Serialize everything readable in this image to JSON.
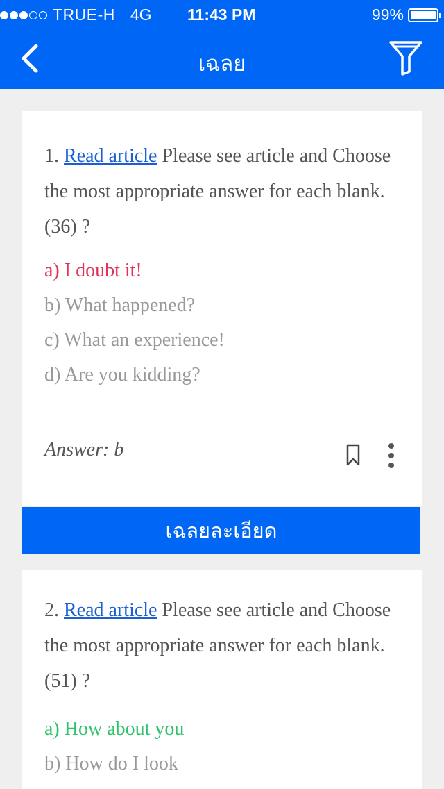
{
  "status_bar": {
    "carrier": "TRUE-H",
    "network": "4G",
    "time": "11:43 PM",
    "battery_percent": "99%",
    "battery_level": 0.99,
    "signal_bars_filled": 3,
    "signal_bars_total": 5
  },
  "nav": {
    "title": "เฉลย",
    "back_icon": "chevron-left-icon",
    "filter_icon": "filter-icon"
  },
  "questions": [
    {
      "number": "1.",
      "link_text": "Read article",
      "text": " Please see article and Choose the most appropriate answer for each blank. (36) ?",
      "options": [
        {
          "label": "a) I doubt it!",
          "state": "wrong"
        },
        {
          "label": "b) What happened?",
          "state": "normal"
        },
        {
          "label": "c) What an experience!",
          "state": "normal"
        },
        {
          "label": "d) Are you kidding?",
          "state": "normal"
        }
      ],
      "answer": "Answer: b",
      "detail_button": "เฉลยละเอียด"
    },
    {
      "number": "2.",
      "link_text": "Read article",
      "text": " Please see article and Choose the most appropriate answer for each blank. (51) ?",
      "options": [
        {
          "label": "a) How about you",
          "state": "right"
        },
        {
          "label": "b) How do I look",
          "state": "normal"
        }
      ]
    }
  ],
  "colors": {
    "primary": "#0066f5",
    "wrong": "#e33157",
    "correct": "#2ec26b",
    "link": "#1a5fd6"
  }
}
